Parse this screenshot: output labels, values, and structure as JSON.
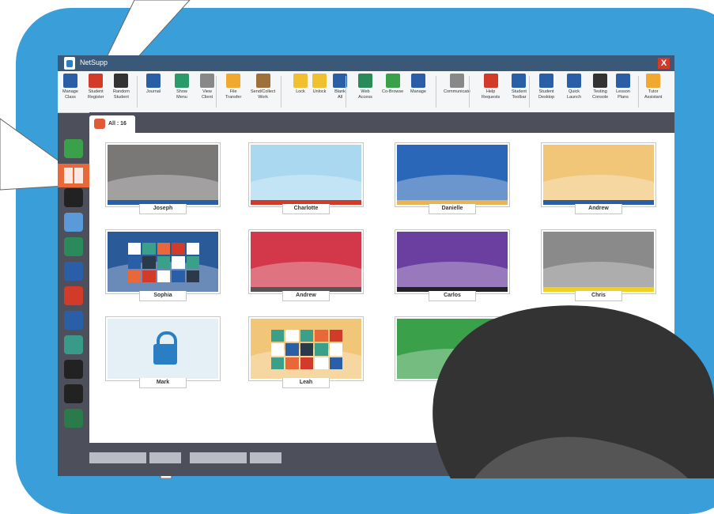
{
  "window": {
    "title": "NetSupp",
    "close_glyph": "X"
  },
  "toolbar": [
    {
      "label": "Manage Class",
      "icon": "manage-class-icon"
    },
    {
      "label": "Student Register",
      "icon": "student-register-icon"
    },
    {
      "label": "Random Student",
      "icon": "random-student-icon"
    },
    {
      "label": "Journal",
      "icon": "journal-icon"
    },
    {
      "label": "Show Menu",
      "icon": "show-icon"
    },
    {
      "label": "View Client",
      "icon": "view-client-icon"
    },
    {
      "label": "File Transfer",
      "icon": "file-transfer-icon"
    },
    {
      "label": "Send/Collect Work",
      "icon": "send-collect-icon"
    },
    {
      "label": "Lock",
      "icon": "lock-icon"
    },
    {
      "label": "Unlock",
      "icon": "unlock-icon"
    },
    {
      "label": "Blank All",
      "icon": "blank-all-icon"
    },
    {
      "label": "Web Access",
      "icon": "web-access-icon"
    },
    {
      "label": "Co-Browse",
      "icon": "co-browse-icon"
    },
    {
      "label": "Manage",
      "icon": "manage-icon"
    },
    {
      "label": "Communicate",
      "icon": "communicate-icon"
    },
    {
      "label": "Help Requests",
      "icon": "help-requests-icon"
    },
    {
      "label": "Student Toolbar",
      "icon": "student-toolbar-icon"
    },
    {
      "label": "Student Desktop",
      "icon": "student-desktop-icon"
    },
    {
      "label": "Quick Launch",
      "icon": "quick-launch-icon"
    },
    {
      "label": "Testing Console",
      "icon": "testing-console-icon"
    },
    {
      "label": "Lesson Plans",
      "icon": "lesson-plans-icon"
    },
    {
      "label": "Tutor Assistant",
      "icon": "tutor-assistant-icon"
    }
  ],
  "tab": {
    "label": "All : 16"
  },
  "sidebar": [
    "home-icon",
    "thumbnails-icon",
    "headphones-icon",
    "help-cloud-icon",
    "globe-icon",
    "window-icon",
    "pie-chart-icon",
    "printer-icon",
    "users-icon",
    "disc-icon",
    "terminal-icon",
    "activity-chart-icon"
  ],
  "students": [
    {
      "name": "Joseph",
      "bg": "#7a7777",
      "bar": "#2a5fa8"
    },
    {
      "name": "Charlotte",
      "bg": "#a9d8f0",
      "bar": "#d23b2a"
    },
    {
      "name": "Danielle",
      "bg": "#2a67b8",
      "bar": "#e8b45a"
    },
    {
      "name": "Andrew",
      "bg": "#f2c679",
      "bar": "#2a5fa8"
    },
    {
      "name": "Sophia",
      "bg": "#2a5a98",
      "bar": ""
    },
    {
      "name": "Andrew",
      "bg": "#d2384a",
      "bar": "#555555"
    },
    {
      "name": "Carlos",
      "bg": "#6a3fa0",
      "bar": "#222222"
    },
    {
      "name": "Chris",
      "bg": "#8a8a8a",
      "bar": "#f0d020"
    },
    {
      "name": "Mark",
      "bg": "#e4f0f6",
      "bar": ""
    },
    {
      "name": "Leah",
      "bg": "#f2c679",
      "bar": ""
    },
    {
      "name": "",
      "bg": "#3aa04a",
      "bar": ""
    }
  ]
}
